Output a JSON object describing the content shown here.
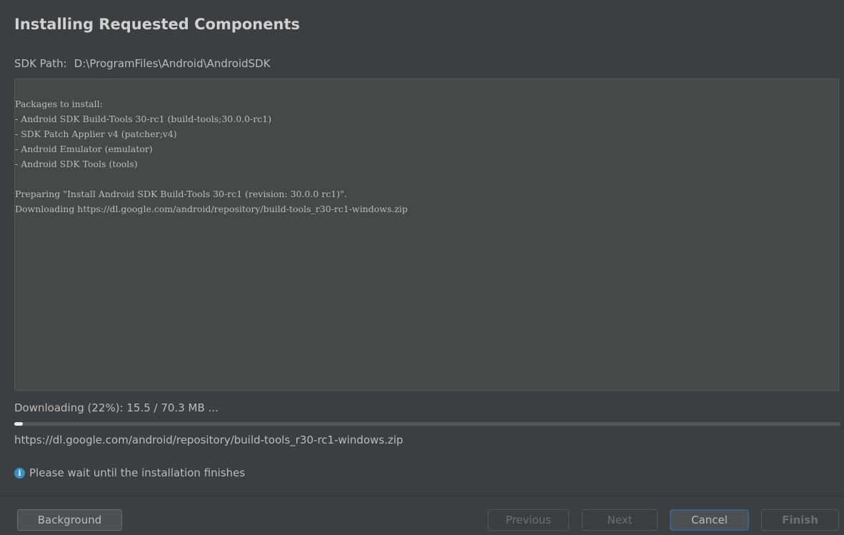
{
  "dialog": {
    "title": "Installing Requested Components",
    "sdk_path_label": "SDK Path:",
    "sdk_path_value": "D:\\ProgramFiles\\Android\\AndroidSDK"
  },
  "console": {
    "lines": [
      "Packages to install:",
      "- Android SDK Build-Tools 30-rc1 (build-tools;30.0.0-rc1)",
      "- SDK Patch Applier v4 (patcher;v4)",
      "- Android Emulator (emulator)",
      "- Android SDK Tools (tools)",
      "",
      "Preparing \"Install Android SDK Build-Tools 30-rc1 (revision: 30.0.0 rc1)\".",
      "Downloading https://dl.google.com/android/repository/build-tools_r30-rc1-windows.zip"
    ]
  },
  "progress": {
    "status_text": "Downloading (22%): 15.5 / 70.3 MB ...",
    "fraction": 0.01,
    "url_text": "https://dl.google.com/android/repository/build-tools_r30-rc1-windows.zip"
  },
  "info": {
    "icon": "info-icon",
    "message": "Please wait until the installation finishes"
  },
  "buttons": {
    "background": "Background",
    "previous": "Previous",
    "next": "Next",
    "cancel": "Cancel",
    "finish": "Finish"
  },
  "colors": {
    "window_bg": "#3c3f41",
    "console_bg": "#45494a",
    "info_icon": "#3592c4",
    "focus_border": "#3d6185"
  }
}
